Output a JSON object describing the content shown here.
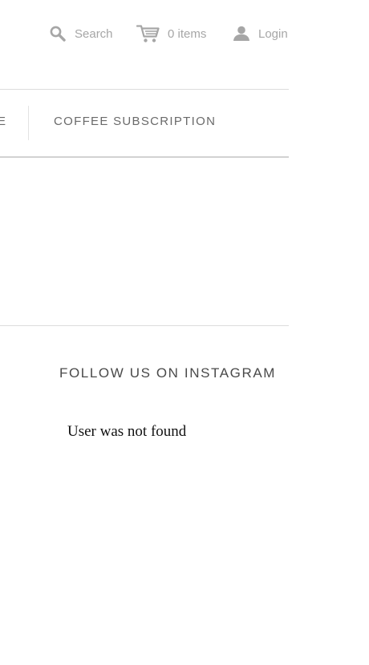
{
  "header": {
    "search_label": "Search",
    "cart_label": "0 items",
    "login_label": "Login",
    "icon_color": "#a6a6a6"
  },
  "nav": {
    "items": [
      {
        "label": "E"
      },
      {
        "label": "COFFEE SUBSCRIPTION"
      }
    ]
  },
  "footer": {
    "instagram_heading": "FOLLOW US ON INSTAGRAM",
    "instagram_message": "User was not found"
  }
}
